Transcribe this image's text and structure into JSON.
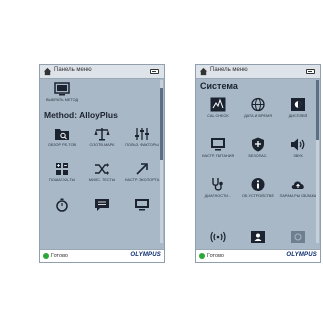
{
  "left": {
    "topbar": {
      "title": "Панель меню"
    },
    "section_title": "Method: AlloyPlus",
    "tiles": [
      {
        "label": "Выбрать метод",
        "icon": "select-method-icon"
      },
      {
        "label": "Обзор ре-тов",
        "icon": "folder-search-icon"
      },
      {
        "label": "Соотв.марк",
        "icon": "scales-icon"
      },
      {
        "label": "Польз. факторы",
        "icon": "sliders-icon"
      },
      {
        "label": "Пошаг.ка-ты",
        "icon": "calculator-icon"
      },
      {
        "label": "Милс. тесты",
        "icon": "shuffle-icon"
      },
      {
        "label": "Настр. экспорта",
        "icon": "export-arrow-icon"
      },
      {
        "label": "",
        "icon": "stopwatch-icon"
      },
      {
        "label": "",
        "icon": "message-icon"
      },
      {
        "label": "",
        "icon": "display-icon"
      }
    ],
    "status": "Готово",
    "logo": "OLYMPUS"
  },
  "right": {
    "topbar": {
      "title": "Панель меню"
    },
    "section_title": "Система",
    "tiles": [
      {
        "label": "Cal Check",
        "icon": "cal-check-icon"
      },
      {
        "label": "Дата и время",
        "icon": "globe-icon"
      },
      {
        "label": "Дисплей",
        "icon": "display-brightness-icon"
      },
      {
        "label": "Настр. питания",
        "icon": "power-display-icon"
      },
      {
        "label": "Безопас.",
        "icon": "shield-icon"
      },
      {
        "label": "Звук",
        "icon": "speaker-icon"
      },
      {
        "label": "Диагности...",
        "icon": "stethoscope-icon"
      },
      {
        "label": "Об устройстве",
        "icon": "info-icon"
      },
      {
        "label": "Парам-ры облака",
        "icon": "cloud-upload-icon"
      },
      {
        "label": "",
        "icon": "wireless-icon"
      },
      {
        "label": "",
        "icon": "contact-card-icon"
      },
      {
        "label": "",
        "icon": "image-icon"
      }
    ],
    "status": "Готово",
    "logo": "OLYMPUS"
  }
}
